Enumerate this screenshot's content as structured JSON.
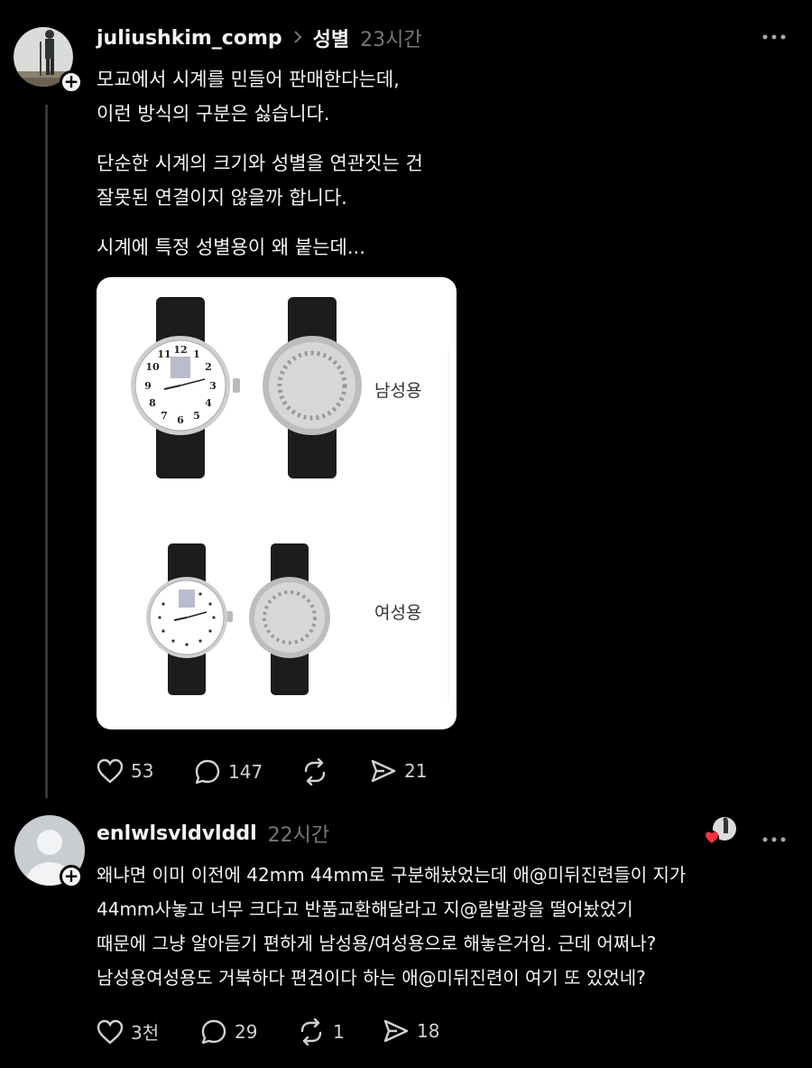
{
  "post": {
    "username": "juliushkim_comp",
    "topic": "성별",
    "time": "23시간",
    "lines": [
      "모교에서 시계를 민들어 판매한다는데,",
      "이런 방식의 구분은 싫습니다.",
      "단순한 시계의 크기와 성별을 연관짓는 건",
      "잘못된 연결이지 않을까 합니다.",
      "시계에 특정 성별용이 왜 붙는데..."
    ],
    "image": {
      "label_top": "남성용",
      "label_bottom": "여성용",
      "dial_numbers": [
        "12",
        "1",
        "2",
        "3",
        "4",
        "5",
        "6",
        "7",
        "8",
        "9",
        "10",
        "11"
      ]
    },
    "stats": {
      "likes": "53",
      "comments": "147",
      "reposts": "",
      "shares": "21"
    }
  },
  "reply": {
    "username": "enlwlsvldvlddl",
    "time": "22시간",
    "lines": [
      "왜냐면 이미 이전에 42mm 44mm로 구분해놨었는데 애@미뒤진련들이 지가",
      "44mm사놓고 너무 크다고 반품교환해달라고 지@랄발광을 떨어놨었기",
      "때문에 그냥 알아듣기 편하게 남성용/여성용으로 해놓은거임. 근데 어쩌나?",
      "남성용여성용도 거북하다 편견이다 하는 애@미뒤진련이 여기 또 있었네?"
    ],
    "stats": {
      "likes": "3천",
      "comments": "29",
      "reposts": "1",
      "shares": "18"
    }
  },
  "icons": {
    "more": "more-horizontal-icon",
    "like": "heart-icon",
    "comment": "comment-bubble-icon",
    "repost": "repost-icon",
    "share": "send-icon",
    "follow": "plus-icon",
    "breadcrumb": "chevron-right-icon"
  },
  "colors": {
    "background": "#000000",
    "text": "#f3f5f7",
    "muted": "#777777",
    "like_heart": "#ff3040"
  }
}
